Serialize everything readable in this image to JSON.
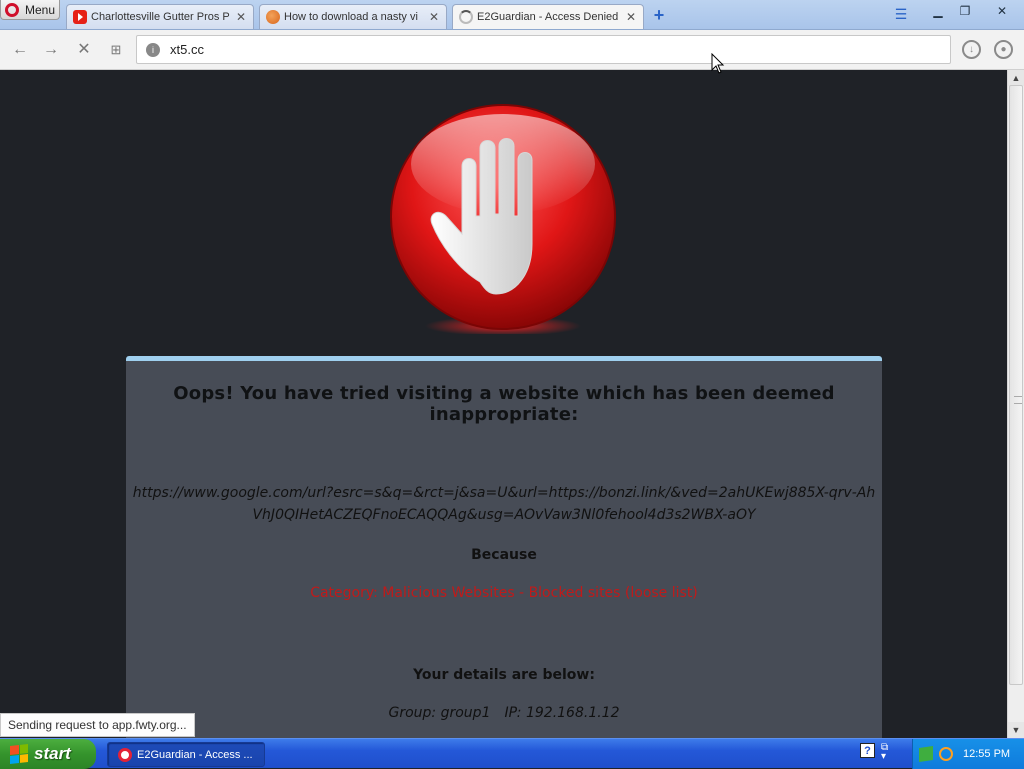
{
  "browser": {
    "menu_label": "Menu",
    "tabs": [
      {
        "title": "Charlottesville Gutter Pros P",
        "icon": "youtube-icon"
      },
      {
        "title": "How to download a nasty vi",
        "icon": "hub-icon"
      },
      {
        "title": "E2Guardian - Access Denied",
        "icon": "loading-spinner-icon"
      }
    ],
    "address": "xt5.cc",
    "status": "Sending request to app.fwty.org..."
  },
  "page": {
    "headline": "Oops! You have tried visiting a website which has been deemed inappropriate:",
    "blocked_url": "https://www.google.com/url?esrc=s&q=&rct=j&sa=U&url=https://bonzi.link/&ved=2ahUKEwj885X-qrv-AhVhJ0QIHetACZEQFnoECAQQAg&usg=AOvVaw3Nl0fehool4d3s2WBX-aOY",
    "because_label": "Because",
    "reason": "Category: Malicious Websites - Blocked sites (loose list)",
    "details_label": "Your details are below:",
    "group": "Group: group1",
    "ip": "IP: 192.168.1.12"
  },
  "taskbar": {
    "start_label": "start",
    "task_title": "E2Guardian - Access ...",
    "clock": "12:55 PM"
  },
  "colors": {
    "panel_bg": "#474c56",
    "panel_top_border": "#9fd0ef",
    "reason_text": "#c01a1a",
    "page_bg": "#1f2227"
  }
}
